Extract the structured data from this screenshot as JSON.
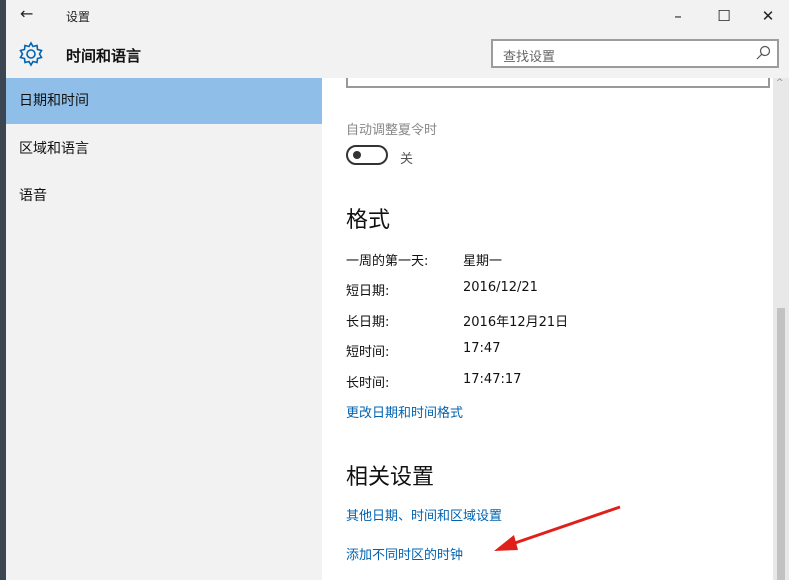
{
  "window": {
    "title": "设置",
    "back_icon": "back-arrow-icon",
    "minimize": "–",
    "maximize": "☐",
    "close": "✕"
  },
  "header": {
    "app_title": "时间和语言",
    "app_icon": "gear-icon",
    "search_placeholder": "查找设置",
    "search_icon": "search-icon"
  },
  "sidebar": {
    "items": [
      {
        "label": "日期和时间",
        "selected": true
      },
      {
        "label": "区域和语言",
        "selected": false
      },
      {
        "label": "语音",
        "selected": false
      }
    ]
  },
  "content": {
    "dst_label": "自动调整夏令时",
    "dst_toggle_state": "关",
    "format_heading": "格式",
    "format_rows": [
      {
        "key": "一周的第一天:",
        "value": "星期一"
      },
      {
        "key": "短日期:",
        "value": "2016/12/21"
      },
      {
        "key": "长日期:",
        "value": "2016年12月21日"
      },
      {
        "key": "短时间:",
        "value": "17:47"
      },
      {
        "key": "长时间:",
        "value": "17:47:17"
      }
    ],
    "change_format_link": "更改日期和时间格式",
    "related_heading": "相关设置",
    "related_links": [
      "其他日期、时间和区域设置",
      "添加不同时区的时钟"
    ]
  },
  "colors": {
    "accent": "#0063b1",
    "selected_nav": "#8fbfe8",
    "annotation_arrow": "#e0201b"
  }
}
